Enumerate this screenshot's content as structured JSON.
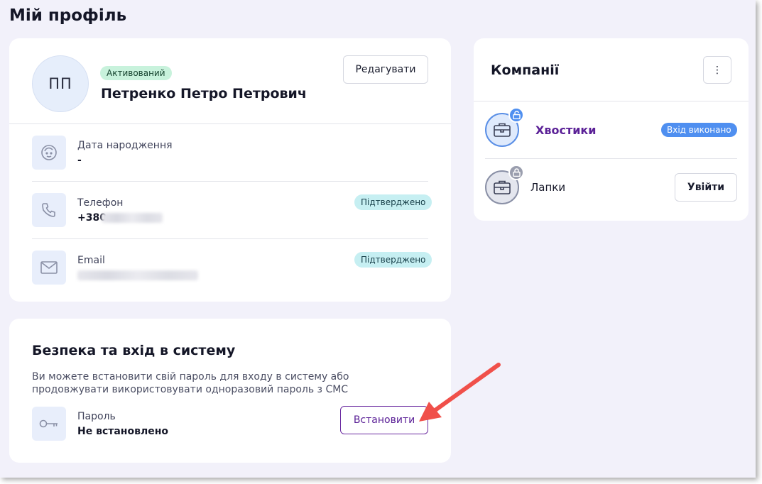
{
  "page": {
    "title": "Мій профіль"
  },
  "profile": {
    "initials": "ПП",
    "status_badge": "Активований",
    "full_name": "Петренко Петро Петрович",
    "edit_label": "Редагувати",
    "birth_label": "Дата народження",
    "birth_value": "-",
    "phone_label": "Телефон",
    "phone_value_prefix": "+380",
    "phone_badge": "Підтверджено",
    "email_label": "Email",
    "email_badge": "Підтверджено"
  },
  "security": {
    "title": "Безпека та вхід в систему",
    "description": "Ви можете встановити свій пароль для входу в систему або продовжувати використовувати одноразовий пароль з СМС",
    "password_label": "Пароль",
    "password_value": "Не встановлено",
    "set_label": "Встановити"
  },
  "companies": {
    "title": "Компанії",
    "more_label": "⋮",
    "items": [
      {
        "name": "Хвостики",
        "badge": "Вхід виконано"
      },
      {
        "name": "Лапки",
        "action_label": "Увійти"
      }
    ]
  },
  "colors": {
    "background": "#f2f1fa",
    "accent_purple": "#5b2197",
    "active_badge": "#c8f2dc",
    "confirm_badge": "#c6eff2",
    "logged_badge": "#4f8ff0",
    "arrow": "#f0504a"
  },
  "icons": [
    "face-icon",
    "phone-icon",
    "mail-icon",
    "key-icon",
    "briefcase-icon",
    "lock-open-icon",
    "lock-closed-icon",
    "more-vertical-icon"
  ]
}
